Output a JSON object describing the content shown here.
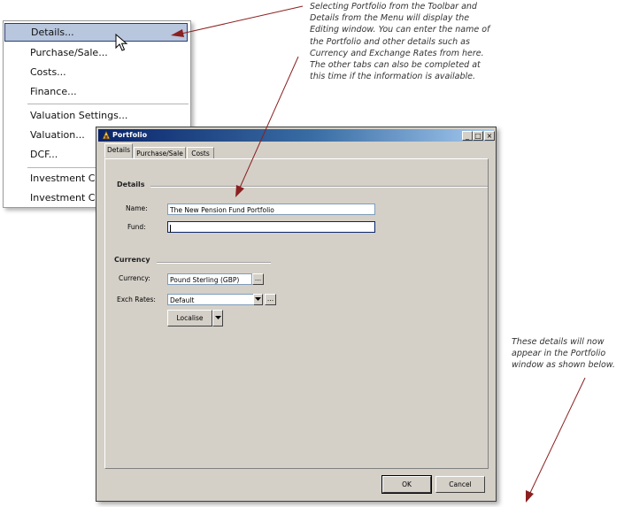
{
  "menu": {
    "items": [
      {
        "label": "Details..."
      },
      {
        "label": "Purchase/Sale..."
      },
      {
        "label": "Costs..."
      },
      {
        "label": "Finance..."
      },
      {
        "label": "Valuation Settings..."
      },
      {
        "label": "Valuation..."
      },
      {
        "label": "DCF..."
      },
      {
        "label": "Investment Co"
      },
      {
        "label": "Investment Co"
      }
    ]
  },
  "annotations": {
    "top": "Selecting Portfolio from the Toolbar and\nDetails from the Menu will display the\nEditing window. You can enter the name of\nthe Portfolio and other details such as\nCurrency and Exchange Rates from here.\nThe other tabs can also be completed at\nthis time if the information is available.",
    "side": "These details will now\nappear in the Portfolio\nwindow as shown below."
  },
  "dialog": {
    "title": "Portfolio",
    "title_buttons": {
      "minimize": "_",
      "maximize": "□",
      "close": "×"
    },
    "tabs": [
      {
        "label": "Details"
      },
      {
        "label": "Purchase/Sale"
      },
      {
        "label": "Costs"
      }
    ],
    "details_section": {
      "title": "Details",
      "name_label": "Name:",
      "name_value": "The New Pension Fund Portfolio",
      "fund_label": "Fund:",
      "fund_value": ""
    },
    "currency_section": {
      "title": "Currency",
      "currency_label": "Currency:",
      "currency_value": "Pound Sterling (GBP)",
      "ellipsis": "...",
      "exch_label": "Exch Rates:",
      "exch_value": "Default",
      "localise_label": "Localise"
    },
    "buttons": {
      "ok": "OK",
      "cancel": "Cancel"
    }
  },
  "colors": {
    "menu_selected_bg": "#b8c6de",
    "dialog_bg": "#d4d0c8",
    "title_gradient_start": "#0a246a",
    "arrow": "#8b2020"
  }
}
